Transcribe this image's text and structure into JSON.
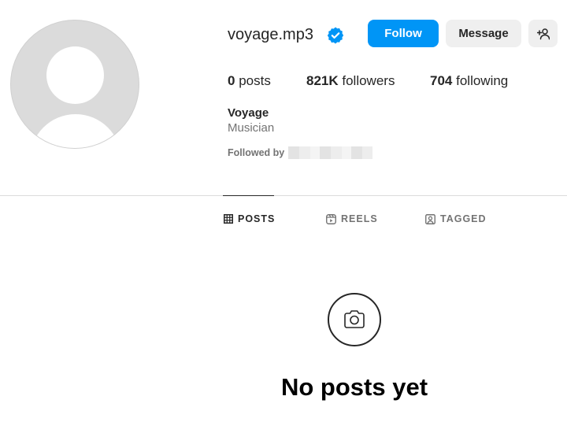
{
  "profile": {
    "username": "voyage.mp3",
    "verified": true,
    "full_name": "Voyage",
    "category": "Musician",
    "followed_by_label": "Followed by"
  },
  "actions": {
    "follow_label": "Follow",
    "message_label": "Message",
    "suggest_icon": "add-person-icon"
  },
  "stats": {
    "posts_count": "0",
    "posts_label": "posts",
    "followers_count": "821K",
    "followers_label": "followers",
    "following_count": "704",
    "following_label": "following"
  },
  "tabs": [
    {
      "label": "POSTS",
      "icon": "grid-icon",
      "active": true
    },
    {
      "label": "REELS",
      "icon": "reels-icon",
      "active": false
    },
    {
      "label": "TAGGED",
      "icon": "tagged-icon",
      "active": false
    }
  ],
  "empty_state": {
    "icon": "camera-icon",
    "title": "No posts yet"
  },
  "colors": {
    "accent": "#0095f6",
    "verified_badge": "#0095f6",
    "text_primary": "#262626",
    "text_secondary": "#737373",
    "button_secondary_bg": "#efefef"
  }
}
